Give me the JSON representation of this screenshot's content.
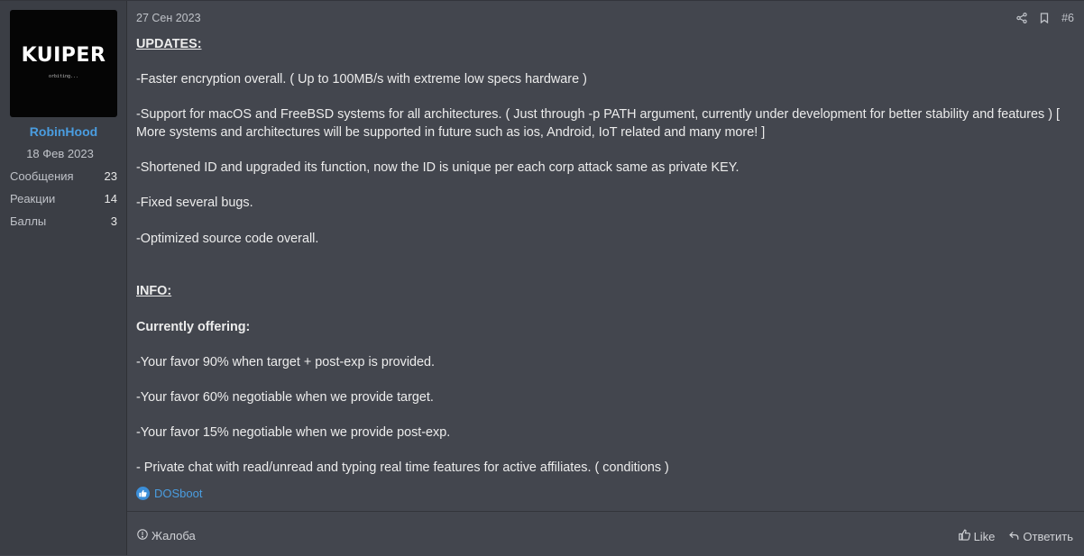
{
  "user": {
    "avatar_logo": "KUIPER",
    "avatar_sub": "orbiting...",
    "username": "RobinHood",
    "joined": "18 Фев 2023",
    "stats": [
      {
        "label": "Сообщения",
        "value": "23"
      },
      {
        "label": "Реакции",
        "value": "14"
      },
      {
        "label": "Баллы",
        "value": "3"
      }
    ]
  },
  "post": {
    "date": "27 Сен 2023",
    "number": "#6",
    "updates_heading": "UPDATES:",
    "updates": [
      "-Faster encryption overall. ( Up to 100MB/s with extreme low specs hardware )",
      "-Support for macOS and FreeBSD systems for all architectures. ( Just through -p PATH argument, currently under development for better stability and features ) [ More systems and architectures will be supported in future such as ios, Android, IoT related and many more! ]",
      "-Shortened ID and upgraded its function, now the ID is unique per each corp attack same as private KEY.",
      "-Fixed several bugs.",
      "-Optimized source code overall."
    ],
    "info_heading": "INFO:",
    "offering_heading": "Currently offering:",
    "offering": [
      "-Your favor 90% when target + post-exp is provided.",
      "-Your favor 60% negotiable when we provide target.",
      "-Your favor 15% negotiable when we provide post-exp.",
      "- Private chat with read/unread and typing real time features for active affiliates. ( conditions )"
    ],
    "reaction_user": "DOSboot"
  },
  "footer": {
    "report_label": "Жалоба",
    "like_label": "Like",
    "reply_label": "Ответить"
  }
}
